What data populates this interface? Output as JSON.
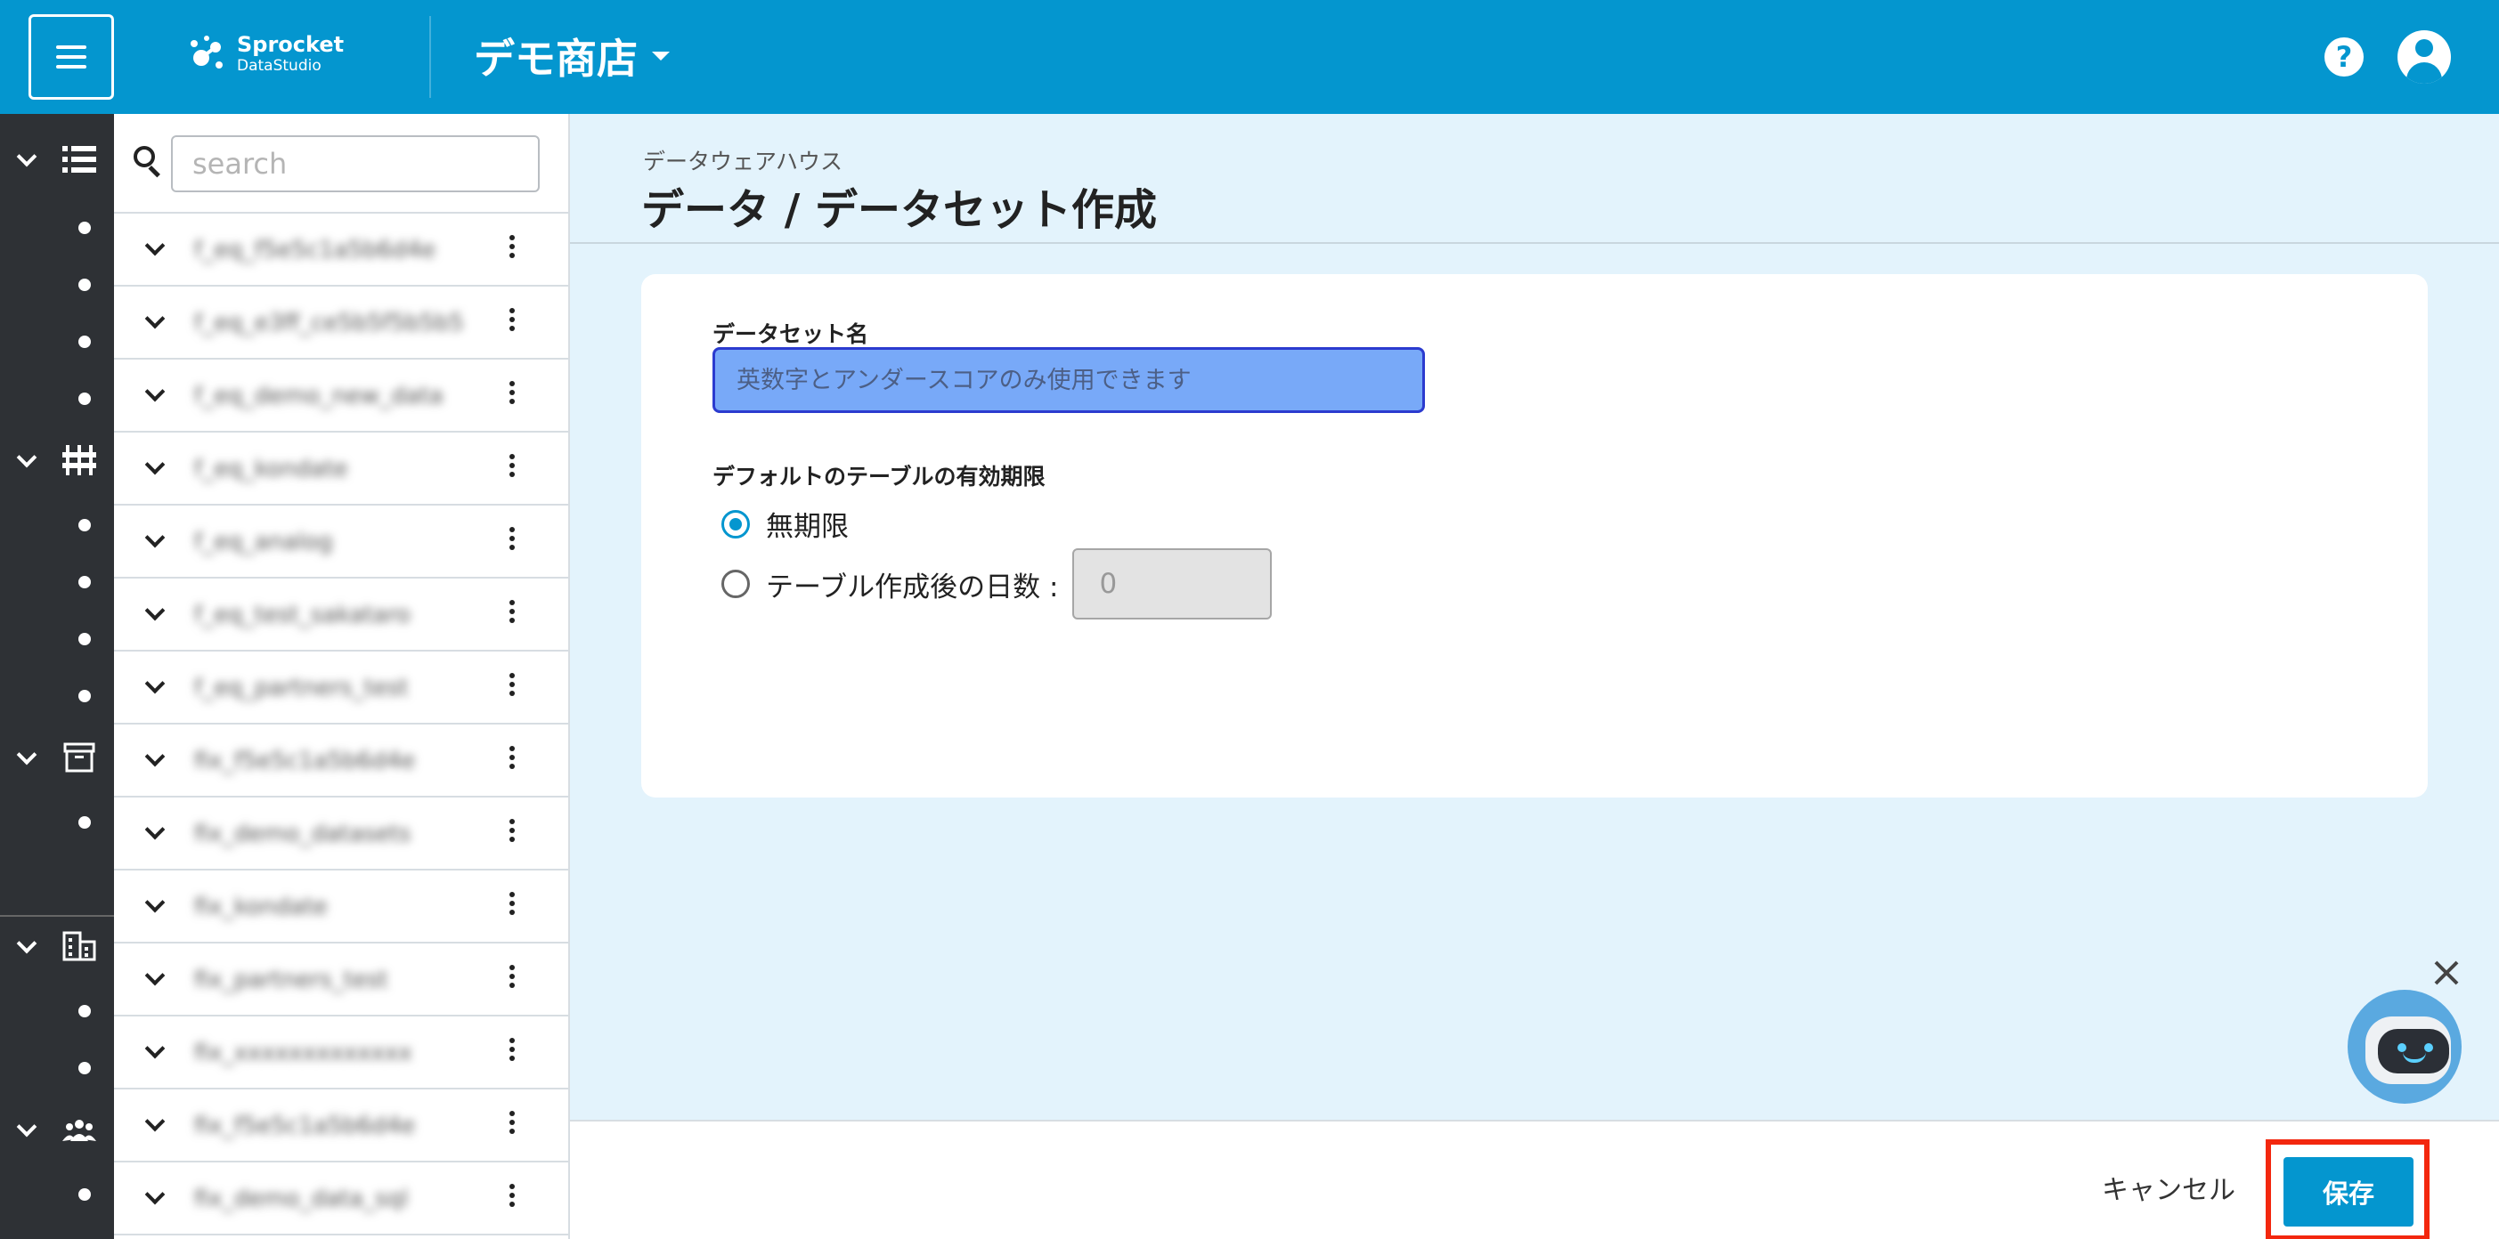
{
  "header": {
    "logo_line1": "Sprocket",
    "logo_line2": "DataStudio",
    "store_name": "デモ商店",
    "help_icon": "help-icon",
    "account_icon": "account-icon",
    "brand_color": "#0496cf"
  },
  "rail": {
    "groups": [
      {
        "icon": "storage-list-icon",
        "items": 4
      },
      {
        "icon": "pipeline-icon",
        "items": 4
      },
      {
        "icon": "archive-icon",
        "items": 1
      },
      {
        "icon": "building-icon",
        "items": 2
      },
      {
        "icon": "people-icon",
        "items": 1
      }
    ]
  },
  "panel": {
    "search_placeholder": "search",
    "datasets": [
      {
        "name": "f_eq_f5e5c1a5b6d4e"
      },
      {
        "name": "f_eq_e3ff_ce5b5f5b5b5"
      },
      {
        "name": "f_eq_demo_new_data"
      },
      {
        "name": "f_eq_kondate"
      },
      {
        "name": "f_eq_analog"
      },
      {
        "name": "f_eq_test_sakataro"
      },
      {
        "name": "f_eq_partners_test"
      },
      {
        "name": "fix_f5e5c1a5b6d4e"
      },
      {
        "name": "fix_demo_datasets"
      },
      {
        "name": "fix_kondate"
      },
      {
        "name": "fix_partners_test"
      },
      {
        "name": "fix_xxxxxxxxxxxxx"
      },
      {
        "name": "fix_f5e5c1a5b6d4e"
      },
      {
        "name": "fix_demo_data_sql"
      }
    ]
  },
  "main": {
    "breadcrumb": "データウェアハウス",
    "title": "データ / データセット作成",
    "form": {
      "dataset_name_label": "データセット名",
      "dataset_name_placeholder": "英数字とアンダースコアのみ使用できます",
      "dataset_name_value": "",
      "expiration_label": "デフォルトのテーブルの有効期限",
      "option_unlimited": "無期限",
      "option_days": "テーブル作成後の日数 :",
      "days_value": "0",
      "selected_option": "unlimited"
    }
  },
  "footer": {
    "cancel_label": "キャンセル",
    "save_label": "保存",
    "highlight_color": "#f3270e"
  },
  "chat": {
    "close_icon": "close-icon",
    "bot_icon": "chatbot-icon"
  }
}
